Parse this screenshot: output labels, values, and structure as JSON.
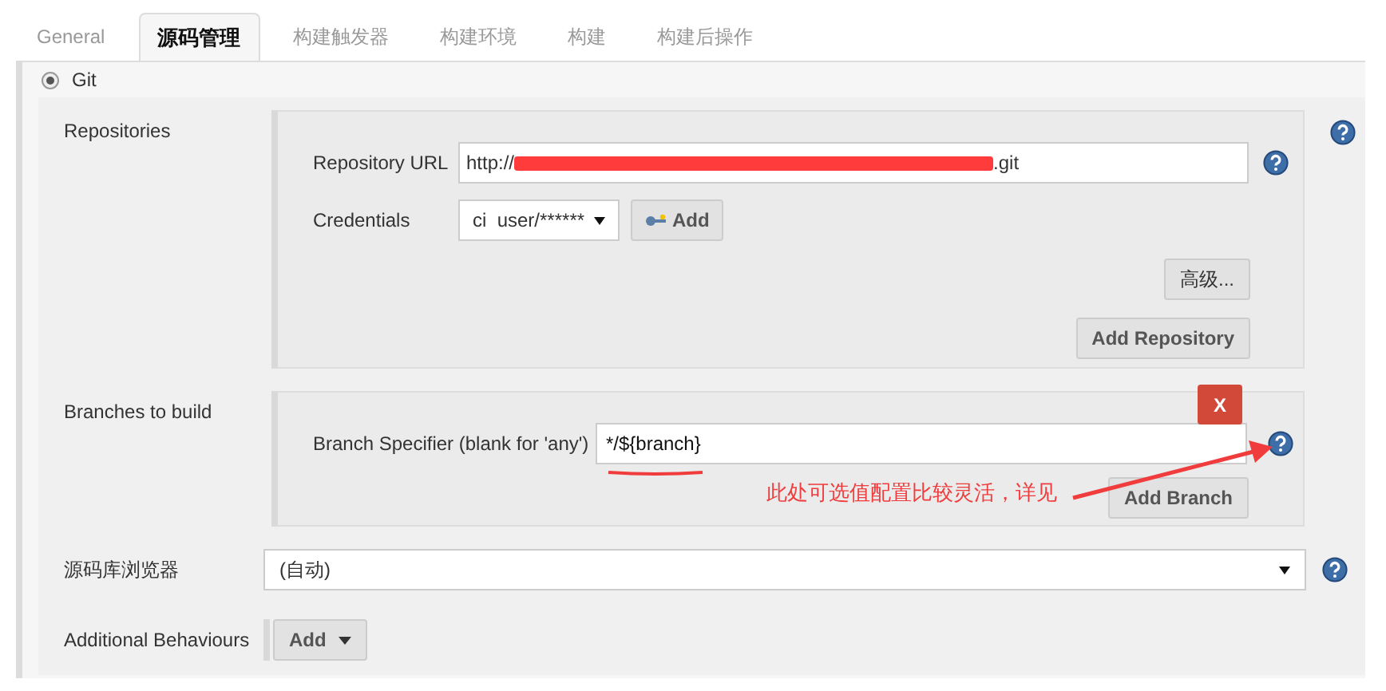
{
  "tabs": [
    {
      "label": "General",
      "selected": false
    },
    {
      "label": "源码管理",
      "selected": true
    },
    {
      "label": "构建触发器",
      "selected": false
    },
    {
      "label": "构建环境",
      "selected": false
    },
    {
      "label": "构建",
      "selected": false
    },
    {
      "label": "构建后操作",
      "selected": false
    }
  ],
  "scm": {
    "label": "Git",
    "selected": true
  },
  "repositories": {
    "label": "Repositories",
    "url_label": "Repository URL",
    "url_prefix": "http://",
    "url_suffix": ".git",
    "redacted": true,
    "credentials_label": "Credentials",
    "credentials_value": "ci  user/******",
    "add_button": "Add",
    "advanced_button": "高级...",
    "add_repository_button": "Add Repository"
  },
  "branches": {
    "label": "Branches to build",
    "delete_button": "X",
    "specifier_label": "Branch Specifier (blank for 'any')",
    "specifier_value": "*/${branch}",
    "add_branch_button": "Add Branch"
  },
  "annotation": {
    "text": "此处可选值配置比较灵活，详见"
  },
  "browser": {
    "label": "源码库浏览器",
    "value": "(自动)"
  },
  "additional_behaviours": {
    "label": "Additional Behaviours",
    "add_button": "Add"
  }
}
